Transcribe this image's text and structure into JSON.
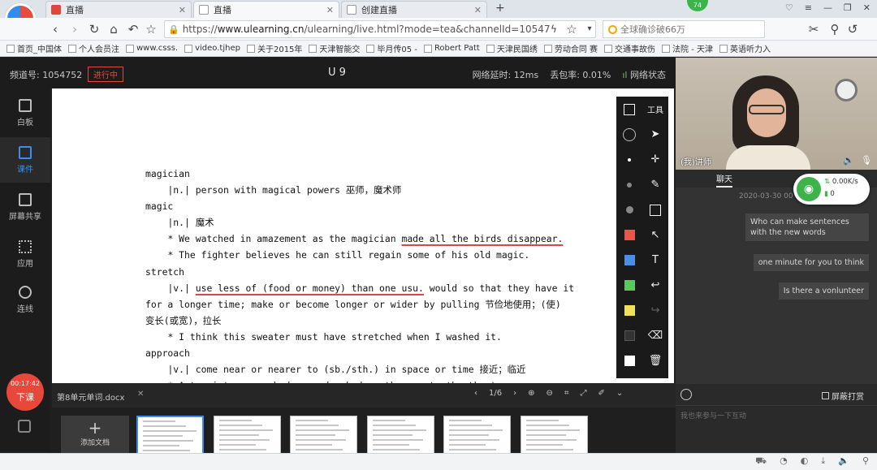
{
  "browser": {
    "tabs": [
      {
        "label": "直播",
        "active": false
      },
      {
        "label": "直播",
        "active": true
      },
      {
        "label": "创建直播",
        "active": false
      }
    ],
    "new_tab": "+",
    "badge_count": "74",
    "url_scheme": "https://",
    "url_host": "www.ulearning.cn",
    "url_rest": "/ulearning/live.html?mode=tea&channelId=10547",
    "search_placeholder": "全球确诊破66万",
    "bookmarks": [
      "首页_中国体",
      "个人会员注",
      "www.csss.",
      "video.tjhep",
      "关于2015年",
      "天津智能交",
      "毕月传05 -",
      "Robert Patt",
      "天津民国绣",
      "劳动合同 赛",
      "交通事故伤",
      "法院 - 天津",
      "英语听力入"
    ]
  },
  "header": {
    "channel": "频道号: 1054752",
    "status": "进行中",
    "title": "U 9",
    "latency": "网络延时: 12ms",
    "loss": "丢包率: 0.01%",
    "net_status": "网络状态"
  },
  "sidebar": {
    "items": [
      {
        "label": "白板",
        "active": false
      },
      {
        "label": "课件",
        "active": true
      },
      {
        "label": "屏幕共享",
        "active": false
      },
      {
        "label": "应用",
        "active": false
      },
      {
        "label": "连线",
        "active": false
      }
    ],
    "timer": "00:17:42",
    "end_label": "下课"
  },
  "document": {
    "lines": [
      {
        "indent": 0,
        "text": "magician"
      },
      {
        "indent": 4,
        "text": "|n.| person with magical powers 巫师，魔术师"
      },
      {
        "indent": 0,
        "text": "magic"
      },
      {
        "indent": 4,
        "text": "|n.| 魔术"
      },
      {
        "indent": 4,
        "pre": "* We watched in amazement as the magician ",
        "underlined": "made all the birds disappear.",
        "post": ""
      },
      {
        "indent": 4,
        "text": "* The fighter believes he can still regain some of his old magic."
      },
      {
        "indent": 0,
        "text": "stretch"
      },
      {
        "indent": 4,
        "pre": "|v.| ",
        "underlined": "use less of (food or money) than one usu.",
        "post": " would so that they have it"
      },
      {
        "indent": 0,
        "text": "for a longer time; make or become longer or wider by pulling 节俭地使用；(使)"
      },
      {
        "indent": 0,
        "text": "变长(或宽)，拉长"
      },
      {
        "indent": 4,
        "text": "* I think this sweater must have stretched when I washed it."
      },
      {
        "indent": 0,
        "text": "approach"
      },
      {
        "indent": 4,
        "text": "|v.| come near or nearer to (sb./sth.) in space or time 接近；临近"
      },
      {
        "indent": 4,
        "text": "* A tourist approached us and asked us the way to the theatre."
      }
    ]
  },
  "toolbar": {
    "tools_label": "工具",
    "colors": [
      "#e8584a",
      "#4a90e2",
      "#5ac85a",
      "#f0e05a",
      "#333333",
      "#ffffff"
    ]
  },
  "docbar": {
    "filename": "第8单元单词.docx",
    "close": "✕",
    "page": "1/6"
  },
  "thumbs": {
    "add_label": "添加文档",
    "count": 6
  },
  "video": {
    "name": "(我)讲师"
  },
  "chat": {
    "tab_label": "聊天",
    "timestamp": "2020-03-30 00",
    "messages": [
      "Who can make sentences with the new words",
      "one minute for you to think",
      "Is there a vonlunteer"
    ],
    "mute_label": "屏蔽打赏",
    "input_placeholder": "我也来参与一下互动"
  },
  "net_widget": {
    "speed": "0.00K/s",
    "battery": "0"
  }
}
